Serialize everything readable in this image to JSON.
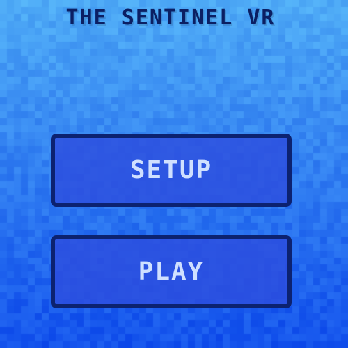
{
  "title": "THE SENTINEL VR",
  "menu": {
    "setup_label": "SETUP",
    "play_label": "PLAY"
  },
  "colors": {
    "background_top": "#4aa9f4",
    "background_bottom": "#1f4fe8",
    "title": "#0b1f63",
    "button_border": "#0c2270",
    "button_fill": "#2d4ede",
    "button_text": "#cfe0ff"
  }
}
